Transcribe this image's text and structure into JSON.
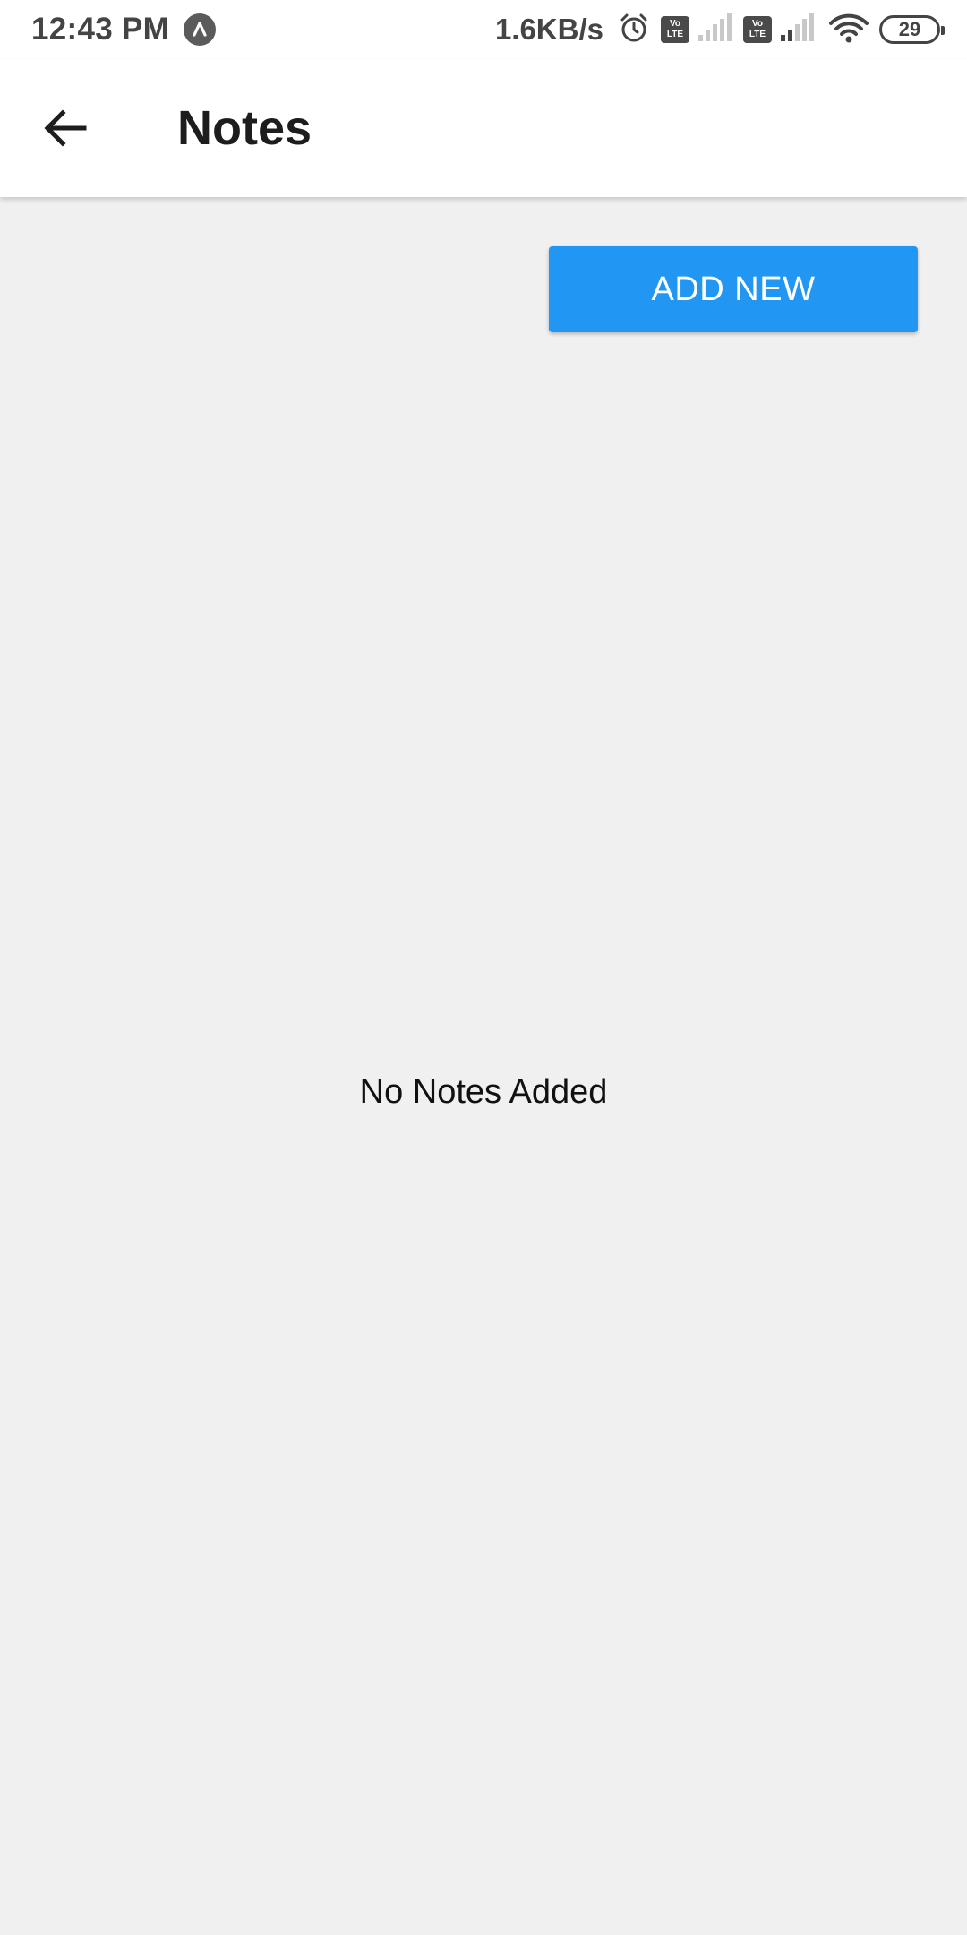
{
  "status_bar": {
    "time": "12:43 PM",
    "net_speed": "1.6KB/s",
    "volte_label": "Vo LTE",
    "battery_level": "29",
    "icons": [
      "navigation-badge-icon",
      "alarm-icon",
      "volte-icon",
      "signal-icon",
      "volte-icon",
      "signal-icon",
      "wifi-icon",
      "battery-icon"
    ]
  },
  "app_bar": {
    "back_icon": "arrow-left-icon",
    "title": "Notes"
  },
  "main": {
    "add_button_label": "ADD NEW",
    "empty_message": "No Notes Added"
  },
  "colors": {
    "primary_button": "#2196f3",
    "background": "#f0f0f0",
    "app_bar": "#ffffff"
  }
}
